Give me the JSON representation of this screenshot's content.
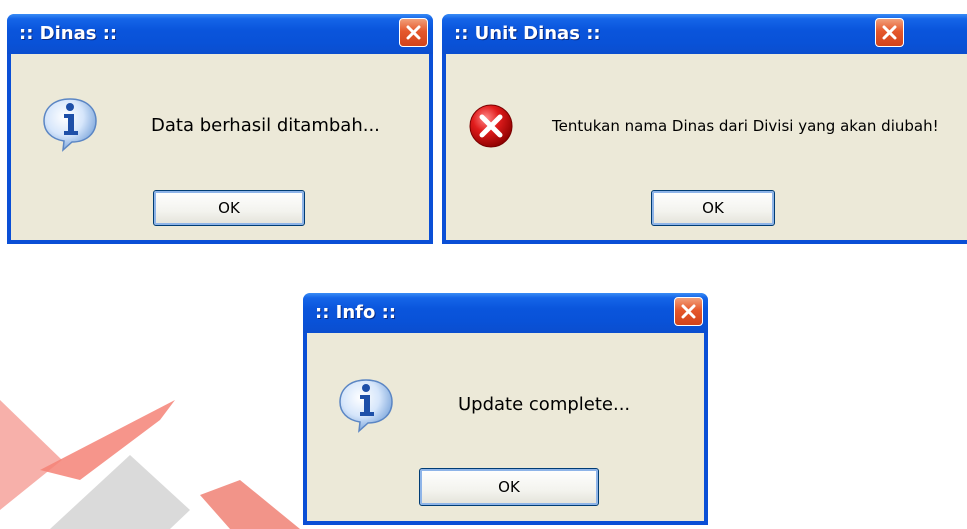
{
  "dialogs": [
    {
      "title": ":: Dinas ::",
      "icon": "info-icon",
      "message": "Data berhasil ditambah...",
      "ok_label": "OK"
    },
    {
      "title": ":: Unit Dinas ::",
      "icon": "error-icon",
      "message": "Tentukan nama Dinas dari Divisi yang akan diubah!",
      "ok_label": "OK"
    },
    {
      "title": ":: Info ::",
      "icon": "info-icon",
      "message": "Update complete...",
      "ok_label": "OK"
    }
  ],
  "colors": {
    "titlebar": "#0a55dc",
    "client": "#ece9d8",
    "close_button": "#e5582c",
    "watermark_red": "#ef6a5d",
    "watermark_gray": "#c8c8c8"
  }
}
